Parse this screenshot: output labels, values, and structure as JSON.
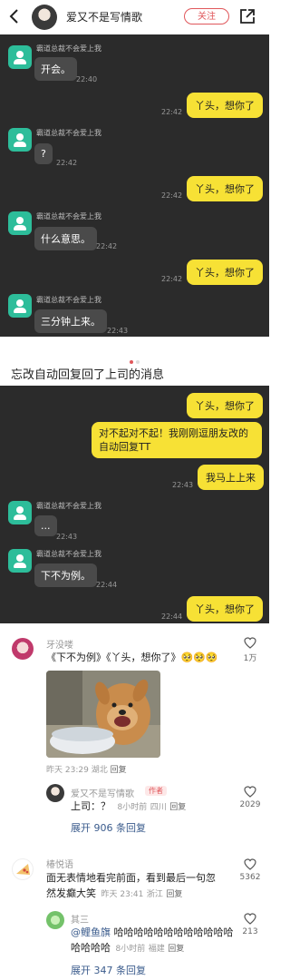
{
  "header": {
    "author": "爱又不是写情歌",
    "follow_label": "关注"
  },
  "chat1": {
    "sender_name": "霸道总裁不会爱上我",
    "messages": [
      {
        "side": "left",
        "text": "开会。",
        "time": "22:40"
      },
      {
        "side": "right",
        "text": "丫头，想你了",
        "time": "22:42"
      },
      {
        "side": "left",
        "text": "?",
        "time": "22:42"
      },
      {
        "side": "right",
        "text": "丫头，想你了",
        "time": "22:42"
      },
      {
        "side": "left",
        "text": "什么意思。",
        "time": "22:42"
      },
      {
        "side": "right",
        "text": "丫头，想你了",
        "time": "22:42"
      },
      {
        "side": "left",
        "text": "三分钟上来。",
        "time": "22:43"
      }
    ]
  },
  "caption": "忘改自动回复回了上司的消息",
  "chat2": {
    "sender_name": "霸道总裁不会爱上我",
    "messages": [
      {
        "side": "right",
        "text": "丫头，想你了"
      },
      {
        "side": "right",
        "text_line1": "对不起对不起！我刚刚逗朋友改的",
        "text_line2": "自动回复TT"
      },
      {
        "side": "right",
        "text": "我马上上来",
        "time": "22:43"
      },
      {
        "side": "left",
        "text": "...",
        "time": "22:43"
      },
      {
        "side": "left",
        "text": "下不为例。",
        "time": "22:44"
      },
      {
        "side": "right",
        "text": "丫头，想你了",
        "time": "22:44"
      }
    ]
  },
  "comments": [
    {
      "user": "牙没喽",
      "text": "《下不为例》《丫头，想你了》",
      "emoji": "🥺🥺🥺",
      "date": "昨天 23:29",
      "location": "湖北",
      "reply_label": "回复",
      "likes": "1万",
      "reply": {
        "user": "爱又不是写情歌",
        "badge": "作者",
        "text": "上司：？",
        "time": "8小时前",
        "location": "四川",
        "reply_label": "回复",
        "likes": "2029",
        "expand": "展开 906 条回复"
      }
    },
    {
      "user": "椿悦语",
      "text_line1": "面无表情地看完前面，看到最后一句忽",
      "text_line2": "然发癫大笑",
      "date": "昨天 23:41",
      "location": "浙江",
      "reply_label": "回复",
      "likes": "5362",
      "reply": {
        "user": "其三",
        "mention": "@鲤鱼旗",
        "text": "哈哈哈哈哈哈哈哈哈哈哈哈",
        "text_line2": "哈哈哈哈",
        "time": "8小时前",
        "location": "福建",
        "reply_label": "回复",
        "likes": "213",
        "expand": "展开 347 条回复"
      }
    }
  ]
}
